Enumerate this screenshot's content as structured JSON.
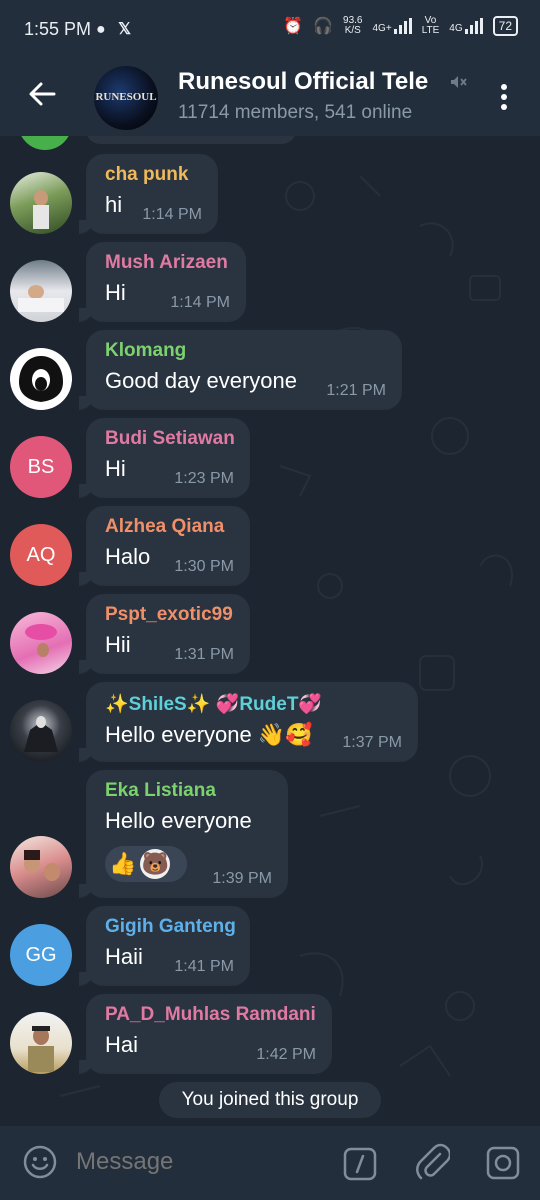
{
  "status": {
    "time": "1:55 PM",
    "speed_top": "93.6",
    "speed_bottom": "K/S",
    "net1": "4G+",
    "net2_top": "Vo",
    "net2_bottom": "LTE",
    "net3": "4G",
    "battery": "72"
  },
  "header": {
    "title": "Runesoul Official Tele",
    "subtitle": "11714 members, 541 online",
    "avatar_text": "RUNESOUL"
  },
  "messages": [
    {
      "name": "cha punk",
      "text": "hi",
      "time": "1:14 PM",
      "name_color": "#f0b95a"
    },
    {
      "name": "Mush Arizaen",
      "text": "Hi",
      "time": "1:14 PM",
      "name_color": "#e07aa3"
    },
    {
      "name": "Klomang",
      "text": "Good day everyone",
      "time": "1:21 PM",
      "name_color": "#7cd26d"
    },
    {
      "name": "Budi Setiawan",
      "text": "Hi",
      "time": "1:23 PM",
      "name_color": "#e07aa3",
      "initials": "BS"
    },
    {
      "name": "Alzhea Qiana",
      "text": "Halo",
      "time": "1:30 PM",
      "name_color": "#f0906a",
      "initials": "AQ"
    },
    {
      "name": "Pspt_exotic99",
      "text": "Hii",
      "time": "1:31 PM",
      "name_color": "#f0906a"
    },
    {
      "name": "✨ShileS✨ 💞RudeT💞",
      "text": "Hello everyone 👋🥰",
      "time": "1:37 PM",
      "name_color": "#5fd0d8"
    },
    {
      "name": "Eka Listiana",
      "text": "Hello everyone",
      "time": "1:39 PM",
      "name_color": "#7cd26d",
      "reactions": [
        "👍",
        "🐻"
      ]
    },
    {
      "name": "Gigih Ganteng",
      "text": "Haii",
      "time": "1:41 PM",
      "name_color": "#5fb0e8",
      "initials": "GG"
    },
    {
      "name": "PA_D_Muhlas Ramdani",
      "text": "Hai",
      "time": "1:42 PM",
      "name_color": "#e07aa3"
    }
  ],
  "system_message": "You joined this group",
  "input": {
    "placeholder": "Message"
  },
  "colors": {
    "header_bg": "#232e3c",
    "bubble_bg": "#2a3440",
    "chat_bg": "#1d2530",
    "avatar_bs": "#e0577a",
    "avatar_aq": "#e05a5a",
    "avatar_gg": "#4b9ee0"
  }
}
